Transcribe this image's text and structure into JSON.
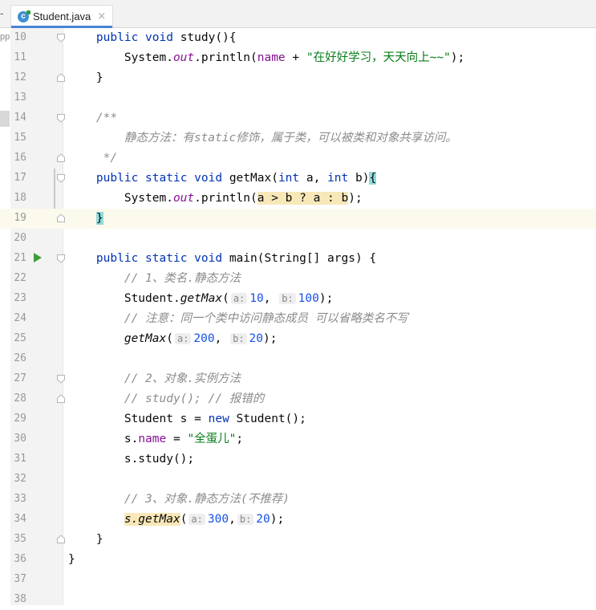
{
  "tab": {
    "cut_label": "-",
    "file_name": "Student.java",
    "icon_letter": "c",
    "close": "×"
  },
  "side": {
    "cut_label": "pp"
  },
  "colors": {
    "keyword": "#0033b3",
    "string": "#067d17",
    "number": "#1750eb",
    "comment": "#8c8c8c",
    "field": "#871094",
    "accent": "#4a83d4"
  },
  "lines": [
    {
      "n": "10",
      "tokens": [
        [
          "    ",
          ""
        ],
        [
          "public",
          "kw"
        ],
        [
          " ",
          ""
        ],
        [
          "void",
          "kw"
        ],
        [
          " study(){",
          ""
        ]
      ],
      "fold": "open"
    },
    {
      "n": "11",
      "tokens": [
        [
          "        System.",
          ""
        ],
        [
          "out",
          "sfld"
        ],
        [
          ".println(",
          ""
        ],
        [
          "name",
          "fld"
        ],
        [
          " + ",
          ""
        ],
        [
          "\"在好好学习，天天向上~~\"",
          "str"
        ],
        [
          ");",
          ""
        ]
      ]
    },
    {
      "n": "12",
      "tokens": [
        [
          "    }",
          ""
        ]
      ],
      "fold": "close"
    },
    {
      "n": "13",
      "tokens": []
    },
    {
      "n": "14",
      "tokens": [
        [
          "    ",
          ""
        ],
        [
          "/**",
          "cmt"
        ]
      ],
      "fold": "open"
    },
    {
      "n": "15",
      "tokens": [
        [
          "        ",
          ""
        ],
        [
          "静态方法：有static修饰，属于类，可以被类和对象共享访问。",
          "cmt"
        ]
      ]
    },
    {
      "n": "16",
      "tokens": [
        [
          "     ",
          ""
        ],
        [
          "*/",
          "cmt"
        ]
      ],
      "fold": "close"
    },
    {
      "n": "17",
      "tokens": [
        [
          "    ",
          ""
        ],
        [
          "public",
          "kw"
        ],
        [
          " ",
          ""
        ],
        [
          "static",
          "kw"
        ],
        [
          " ",
          ""
        ],
        [
          "void",
          "kw"
        ],
        [
          " getMax(",
          ""
        ],
        [
          "int",
          "kw"
        ],
        [
          " a, ",
          ""
        ],
        [
          "int",
          "kw"
        ],
        [
          " b)",
          ""
        ],
        [
          "{",
          "teal"
        ]
      ],
      "fold": "open"
    },
    {
      "n": "18",
      "tokens": [
        [
          "        System.",
          ""
        ],
        [
          "out",
          "sfld"
        ],
        [
          ".println(",
          ""
        ],
        [
          "a > b ? a : b",
          "yellow"
        ],
        [
          ");",
          ""
        ]
      ]
    },
    {
      "n": "19",
      "tokens": [
        [
          "    ",
          ""
        ],
        [
          "}",
          "teal"
        ]
      ],
      "fold": "close",
      "current": true
    },
    {
      "n": "20",
      "tokens": []
    },
    {
      "n": "21",
      "tokens": [
        [
          "    ",
          ""
        ],
        [
          "public",
          "kw"
        ],
        [
          " ",
          ""
        ],
        [
          "static",
          "kw"
        ],
        [
          " ",
          ""
        ],
        [
          "void",
          "kw"
        ],
        [
          " main(String[] args) {",
          ""
        ]
      ],
      "fold": "open",
      "run": true
    },
    {
      "n": "22",
      "tokens": [
        [
          "        ",
          ""
        ],
        [
          "// 1、类名.静态方法",
          "cmt"
        ]
      ]
    },
    {
      "n": "23",
      "tokens": [
        [
          "        Student.",
          ""
        ],
        [
          "getMax",
          "smeth"
        ],
        [
          "(",
          ""
        ],
        [
          "a:",
          "hint"
        ],
        [
          "10",
          "num"
        ],
        [
          ", ",
          ""
        ],
        [
          "b:",
          "hint"
        ],
        [
          "100",
          "num"
        ],
        [
          ");",
          ""
        ]
      ]
    },
    {
      "n": "24",
      "tokens": [
        [
          "        ",
          ""
        ],
        [
          "// 注意：同一个类中访问静态成员 可以省略类名不写",
          "cmt"
        ]
      ]
    },
    {
      "n": "25",
      "tokens": [
        [
          "        ",
          ""
        ],
        [
          "getMax",
          "smeth"
        ],
        [
          "(",
          ""
        ],
        [
          "a:",
          "hint"
        ],
        [
          "200",
          "num"
        ],
        [
          ", ",
          ""
        ],
        [
          "b:",
          "hint"
        ],
        [
          "20",
          "num"
        ],
        [
          ");",
          ""
        ]
      ]
    },
    {
      "n": "26",
      "tokens": []
    },
    {
      "n": "27",
      "tokens": [
        [
          "        ",
          ""
        ],
        [
          "// 2、对象.实例方法",
          "cmt"
        ]
      ],
      "fold": "open"
    },
    {
      "n": "28",
      "tokens": [
        [
          "        ",
          ""
        ],
        [
          "// study(); // 报错的",
          "cmt"
        ]
      ],
      "fold": "close"
    },
    {
      "n": "29",
      "tokens": [
        [
          "        Student s = ",
          ""
        ],
        [
          "new",
          "kw"
        ],
        [
          " Student();",
          ""
        ]
      ]
    },
    {
      "n": "30",
      "tokens": [
        [
          "        s.",
          ""
        ],
        [
          "name",
          "fld"
        ],
        [
          " = ",
          ""
        ],
        [
          "\"全蛋儿\"",
          "str"
        ],
        [
          ";",
          ""
        ]
      ]
    },
    {
      "n": "31",
      "tokens": [
        [
          "        s.study();",
          ""
        ]
      ]
    },
    {
      "n": "32",
      "tokens": []
    },
    {
      "n": "33",
      "tokens": [
        [
          "        ",
          ""
        ],
        [
          "// 3、对象.静态方法(不推荐)",
          "cmt"
        ]
      ]
    },
    {
      "n": "34",
      "tokens": [
        [
          "        ",
          ""
        ],
        [
          "s.getMax",
          "yellowsmeth"
        ],
        [
          "(",
          ""
        ],
        [
          "a:",
          "hint"
        ],
        [
          "300",
          "num"
        ],
        [
          ",",
          ""
        ],
        [
          "b:",
          "hint"
        ],
        [
          "20",
          "num"
        ],
        [
          ");",
          ""
        ]
      ]
    },
    {
      "n": "35",
      "tokens": [
        [
          "    }",
          ""
        ]
      ],
      "fold": "close"
    },
    {
      "n": "36",
      "tokens": [
        [
          "}",
          ""
        ]
      ]
    },
    {
      "n": "37",
      "tokens": []
    },
    {
      "n": "38",
      "tokens": []
    }
  ]
}
